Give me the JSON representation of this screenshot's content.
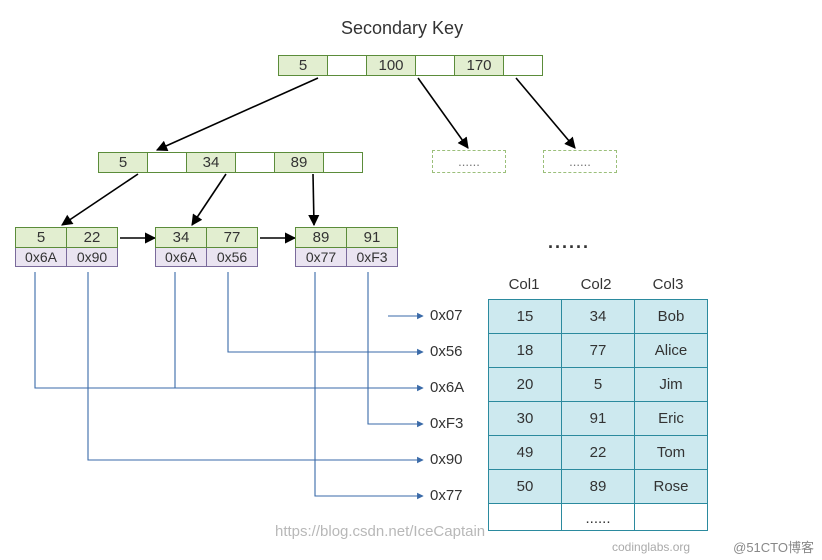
{
  "title": "Secondary Key",
  "root": {
    "keys": [
      "5",
      "100",
      "170"
    ]
  },
  "mid": {
    "keys": [
      "5",
      "34",
      "89"
    ]
  },
  "leaves": [
    {
      "keys": [
        "5",
        "22"
      ],
      "ptrs": [
        "0x6A",
        "0x90"
      ]
    },
    {
      "keys": [
        "34",
        "77"
      ],
      "ptrs": [
        "0x6A",
        "0x56"
      ]
    },
    {
      "keys": [
        "89",
        "91"
      ],
      "ptrs": [
        "0x77",
        "0xF3"
      ]
    }
  ],
  "ghosts": [
    "......",
    "......"
  ],
  "leaf_ellipsis": "......",
  "addresses": [
    "0x07",
    "0x56",
    "0x6A",
    "0xF3",
    "0x90",
    "0x77"
  ],
  "table": {
    "headers": [
      "Col1",
      "Col2",
      "Col3"
    ],
    "rows": [
      [
        "15",
        "34",
        "Bob"
      ],
      [
        "18",
        "77",
        "Alice"
      ],
      [
        "20",
        "5",
        "Jim"
      ],
      [
        "30",
        "91",
        "Eric"
      ],
      [
        "49",
        "22",
        "Tom"
      ],
      [
        "50",
        "89",
        "Rose"
      ]
    ],
    "empty_row": "......"
  },
  "watermark1": "https://blog.csdn.net/IceCaptain",
  "watermark2": "codinglabs.org",
  "credit": "@51CTO博客"
}
